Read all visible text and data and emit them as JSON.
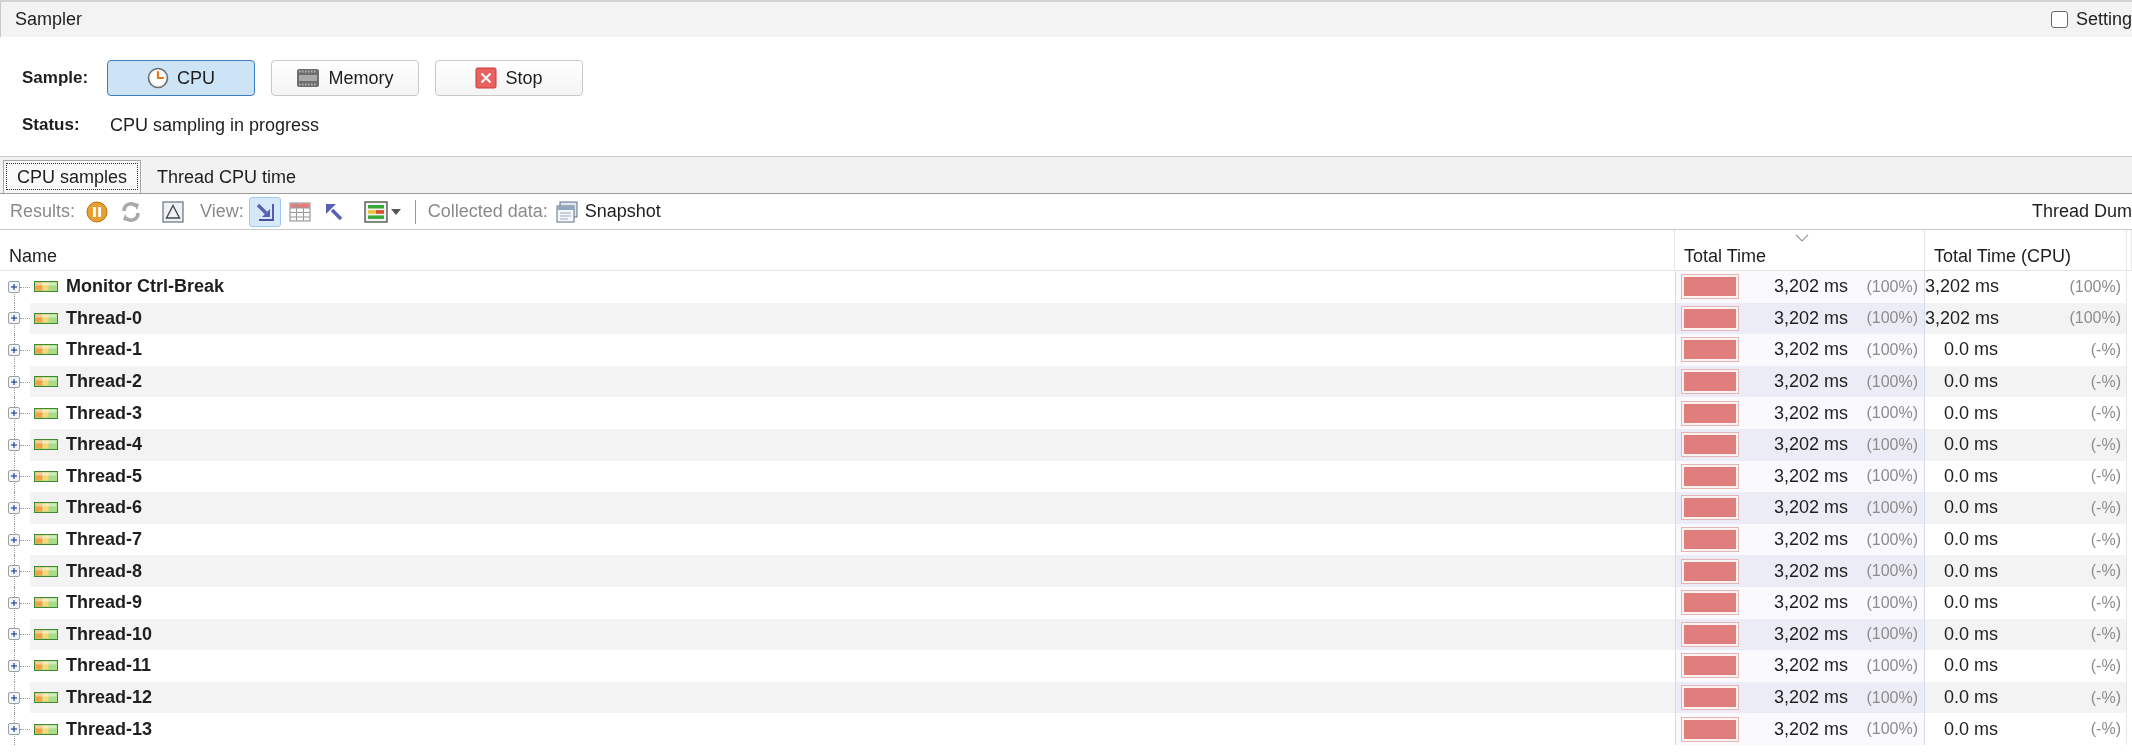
{
  "header": {
    "title": "Sampler",
    "settings": {
      "label": "Setting",
      "checked": false
    }
  },
  "sample": {
    "label": "Sample:",
    "buttons": [
      {
        "kind": "cpu",
        "label": "CPU",
        "selected": true
      },
      {
        "kind": "memory",
        "label": "Memory",
        "selected": false
      },
      {
        "kind": "stop",
        "label": "Stop",
        "selected": false
      }
    ]
  },
  "status": {
    "label": "Status:",
    "value": "CPU sampling in progress"
  },
  "tabs": [
    {
      "label": "CPU samples",
      "selected": true
    },
    {
      "label": "Thread CPU time",
      "selected": false
    }
  ],
  "toolbar": {
    "results_label": "Results:",
    "results_buttons": [
      {
        "kind": "pause",
        "disabled": false
      },
      {
        "kind": "refresh",
        "disabled": true
      },
      {
        "kind": "delta",
        "disabled": false
      }
    ],
    "view_label": "View:",
    "view_buttons": [
      {
        "kind": "forward",
        "selected": true
      },
      {
        "kind": "table",
        "selected": false
      },
      {
        "kind": "back",
        "selected": false
      },
      {
        "kind": "layout",
        "selected": false
      }
    ],
    "collected_label": "Collected data:",
    "snapshot": "Snapshot",
    "thread_dump": "Thread Dum"
  },
  "table": {
    "columns": [
      {
        "label": "Name",
        "sorted": false
      },
      {
        "label": "Total Time",
        "sorted": true
      },
      {
        "label": "Total Time (CPU)",
        "sorted": false
      }
    ],
    "rows": [
      {
        "name": "Monitor Ctrl-Break",
        "expanded": false,
        "total_time": "3,202 ms",
        "total_pct": "(100%)",
        "level": 1,
        "cpu_time": "3,202 ms",
        "cpu_pct": "(100%)"
      },
      {
        "name": "Thread-0",
        "expanded": false,
        "total_time": "3,202 ms",
        "total_pct": "(100%)",
        "level": 1,
        "cpu_time": "3,202 ms",
        "cpu_pct": "(100%)"
      },
      {
        "name": "Thread-1",
        "expanded": false,
        "total_time": "3,202 ms",
        "total_pct": "(100%)",
        "level": 1,
        "cpu_time": "0.0 ms",
        "cpu_pct": "(-%)"
      },
      {
        "name": "Thread-2",
        "expanded": false,
        "total_time": "3,202 ms",
        "total_pct": "(100%)",
        "level": 1,
        "cpu_time": "0.0 ms",
        "cpu_pct": "(-%)"
      },
      {
        "name": "Thread-3",
        "expanded": false,
        "total_time": "3,202 ms",
        "total_pct": "(100%)",
        "level": 1,
        "cpu_time": "0.0 ms",
        "cpu_pct": "(-%)"
      },
      {
        "name": "Thread-4",
        "expanded": false,
        "total_time": "3,202 ms",
        "total_pct": "(100%)",
        "level": 1,
        "cpu_time": "0.0 ms",
        "cpu_pct": "(-%)"
      },
      {
        "name": "Thread-5",
        "expanded": false,
        "total_time": "3,202 ms",
        "total_pct": "(100%)",
        "level": 1,
        "cpu_time": "0.0 ms",
        "cpu_pct": "(-%)"
      },
      {
        "name": "Thread-6",
        "expanded": false,
        "total_time": "3,202 ms",
        "total_pct": "(100%)",
        "level": 1,
        "cpu_time": "0.0 ms",
        "cpu_pct": "(-%)"
      },
      {
        "name": "Thread-7",
        "expanded": false,
        "total_time": "3,202 ms",
        "total_pct": "(100%)",
        "level": 1,
        "cpu_time": "0.0 ms",
        "cpu_pct": "(-%)"
      },
      {
        "name": "Thread-8",
        "expanded": false,
        "total_time": "3,202 ms",
        "total_pct": "(100%)",
        "level": 1,
        "cpu_time": "0.0 ms",
        "cpu_pct": "(-%)"
      },
      {
        "name": "Thread-9",
        "expanded": false,
        "total_time": "3,202 ms",
        "total_pct": "(100%)",
        "level": 1,
        "cpu_time": "0.0 ms",
        "cpu_pct": "(-%)"
      },
      {
        "name": "Thread-10",
        "expanded": false,
        "total_time": "3,202 ms",
        "total_pct": "(100%)",
        "level": 1,
        "cpu_time": "0.0 ms",
        "cpu_pct": "(-%)"
      },
      {
        "name": "Thread-11",
        "expanded": false,
        "total_time": "3,202 ms",
        "total_pct": "(100%)",
        "level": 1,
        "cpu_time": "0.0 ms",
        "cpu_pct": "(-%)"
      },
      {
        "name": "Thread-12",
        "expanded": false,
        "total_time": "3,202 ms",
        "total_pct": "(100%)",
        "level": 1,
        "cpu_time": "0.0 ms",
        "cpu_pct": "(-%)"
      },
      {
        "name": "Thread-13",
        "expanded": false,
        "total_time": "3,202 ms",
        "total_pct": "(100%)",
        "level": 1,
        "cpu_time": "0.0 ms",
        "cpu_pct": "(-%)"
      }
    ]
  }
}
